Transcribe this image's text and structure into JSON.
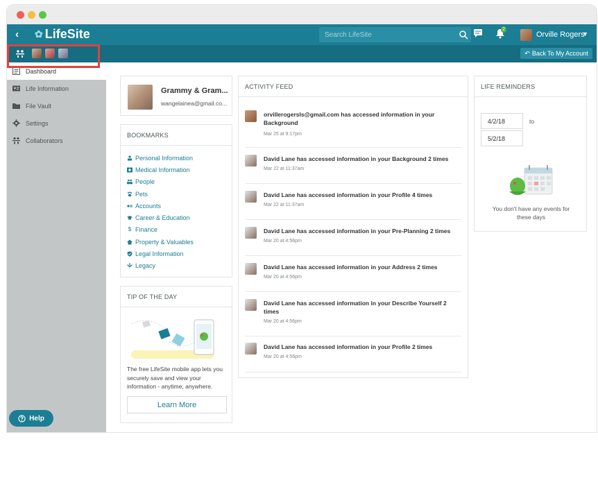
{
  "app": {
    "logo_text": "LifeSite",
    "search_placeholder": "Search LifeSite",
    "notification_count": "2",
    "user_name": "Orville Rogers",
    "back_to_account": "Back To My Account"
  },
  "sidebar": {
    "items": [
      {
        "label": "Dashboard",
        "icon": "dashboard-icon"
      },
      {
        "label": "Life Information",
        "icon": "id-card-icon"
      },
      {
        "label": "File Vault",
        "icon": "folder-icon"
      },
      {
        "label": "Settings",
        "icon": "gear-icon"
      },
      {
        "label": "Collaborators",
        "icon": "people-icon"
      }
    ],
    "help_label": "Help"
  },
  "profile": {
    "name": "Grammy & Gram...",
    "email": "wangelainea@gmail.co..."
  },
  "bookmarks": {
    "title": "BOOKMARKS",
    "items": [
      {
        "label": "Personal Information",
        "icon": "person-icon"
      },
      {
        "label": "Medical Information",
        "icon": "medical-icon"
      },
      {
        "label": "People",
        "icon": "people-icon"
      },
      {
        "label": "Pets",
        "icon": "paw-icon"
      },
      {
        "label": "Accounts",
        "icon": "accounts-icon"
      },
      {
        "label": "Career & Education",
        "icon": "graduation-icon"
      },
      {
        "label": "Finance",
        "icon": "dollar-icon"
      },
      {
        "label": "Property & Valuables",
        "icon": "house-icon"
      },
      {
        "label": "Legal Information",
        "icon": "shield-icon"
      },
      {
        "label": "Legacy",
        "icon": "legacy-icon"
      }
    ]
  },
  "tip": {
    "title": "TIP OF THE DAY",
    "text": "The free LifeSite mobile app lets you securely save and view your information - anytime, anywhere.",
    "button": "Learn More"
  },
  "feed": {
    "title": "ACTIVITY FEED",
    "items": [
      {
        "text": "orvillerogersls@gmail.com has accessed information in your Background",
        "time": "Mar 25 at 9:17pm"
      },
      {
        "text": "David Lane has accessed information in your Background 2 times",
        "time": "Mar 22 at 11:37am"
      },
      {
        "text": "David Lane has accessed information in your Profile 4 times",
        "time": "Mar 22 at 11:37am"
      },
      {
        "text": "David Lane has accessed information in your Pre-Planning 2 times",
        "time": "Mar 20 at 4:56pm"
      },
      {
        "text": "David Lane has accessed information in your Address 2 times",
        "time": "Mar 20 at 4:56pm"
      },
      {
        "text": "David Lane has accessed information in your Describe Yourself 2 times",
        "time": "Mar 20 at 4:56pm"
      },
      {
        "text": "David Lane has accessed information in your Profile 2 times",
        "time": "Mar 20 at 4:56pm"
      }
    ]
  },
  "reminders": {
    "title": "LIFE REMINDERS",
    "from_date": "4/2/18",
    "to_label": "to",
    "to_date": "5/2/18",
    "empty_text": "You don't have any events for these days"
  },
  "colors": {
    "brand": "#1b7e94",
    "brand_dark": "#166c80",
    "sidebar": "#c3c6c7",
    "highlight": "#e0433a"
  }
}
